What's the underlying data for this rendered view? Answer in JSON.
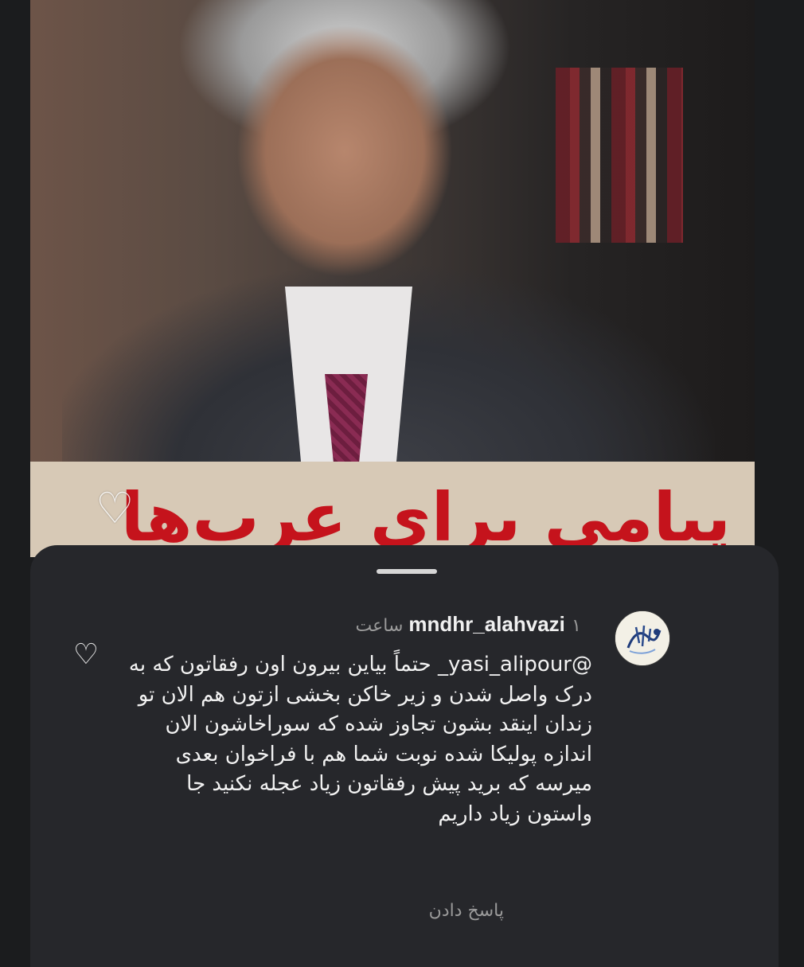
{
  "post": {
    "caption_overlay": "پیامی برای عرب‌ها"
  },
  "comment": {
    "username": "mndhr_alahvazi",
    "time": "۱ ساعت",
    "mention": "yasi_alipour_",
    "text": "حتماً بیاین بیرون اون رفقاتون که به درک واصل شدن و زیر خاکن بخشی ازتون هم الان تو زندان اینقد بشون تجاوز شده که سوراخاشون الان اندازه پولیکا شده نوبت شما هم با فراخوان بعدی میرسه که برید پیش رفقاتون زیاد عجله نکنید جا واستون زیاد داریم",
    "reply_label": "پاسخ دادن"
  },
  "icons": {
    "image_like": "heart-outline-icon",
    "comment_like": "heart-outline-icon",
    "mention_platform": "threads-icon"
  }
}
